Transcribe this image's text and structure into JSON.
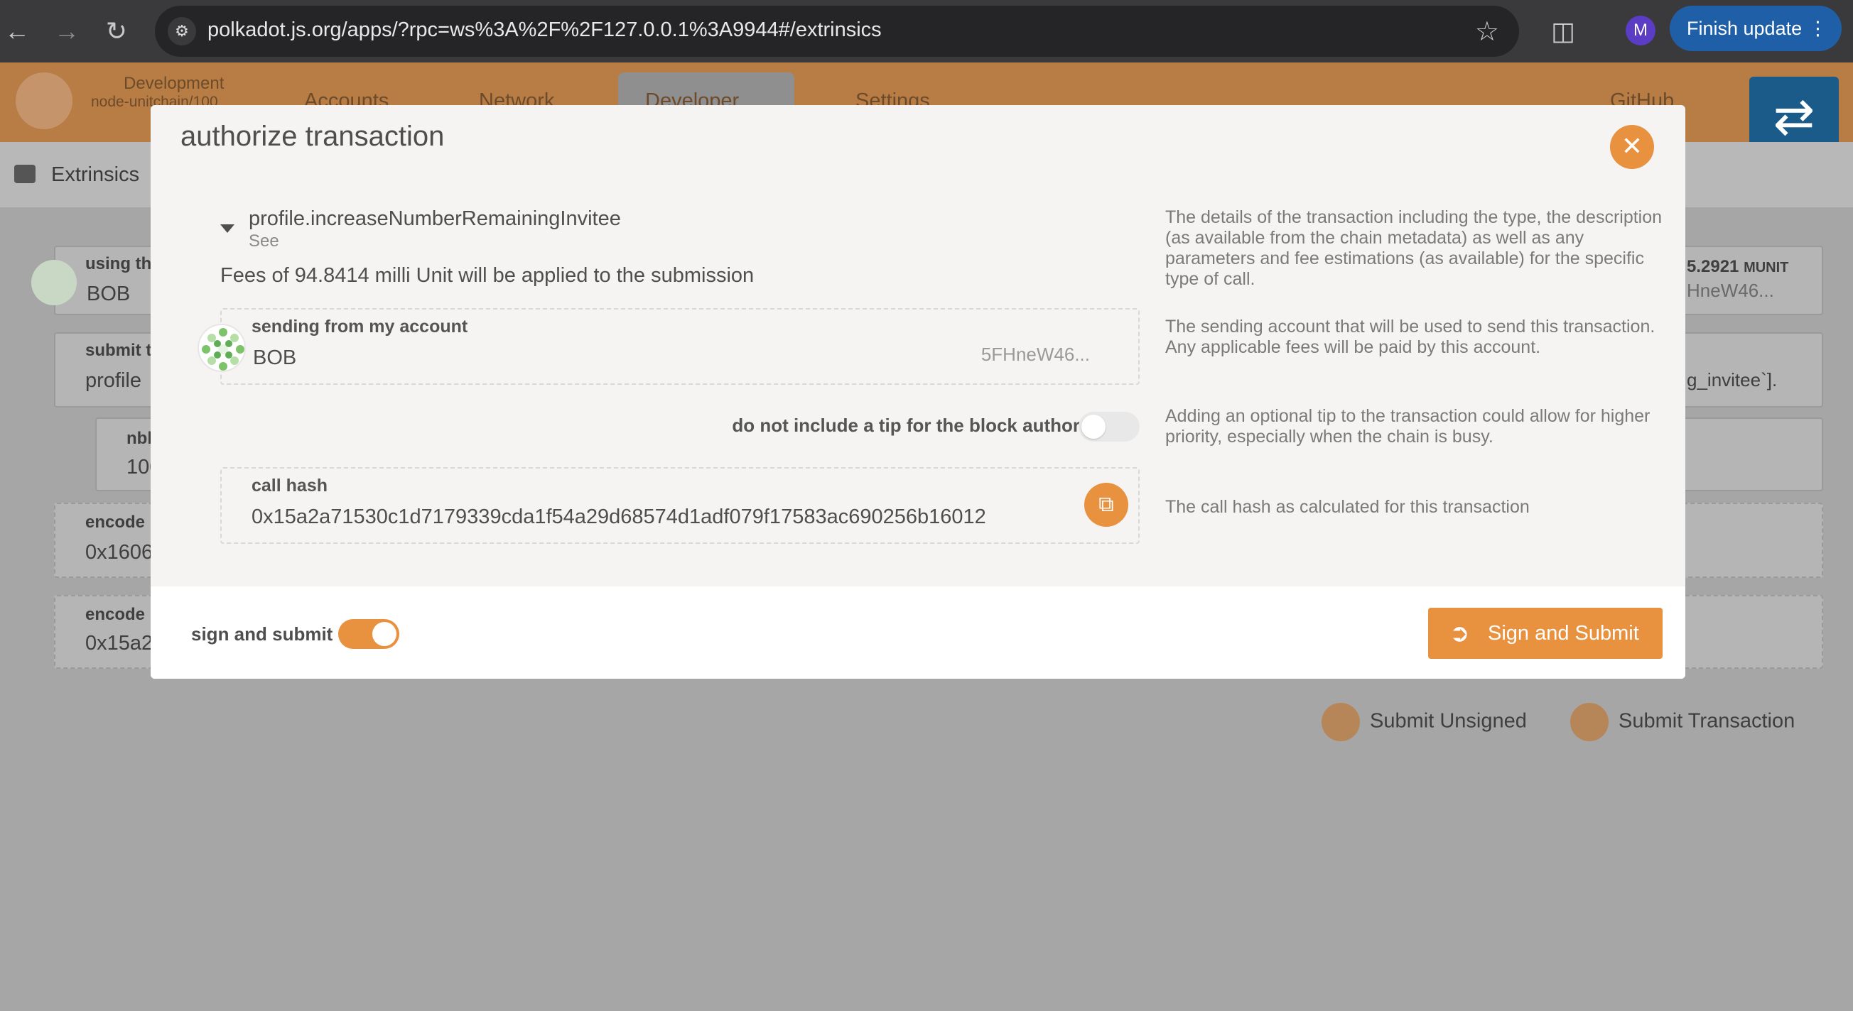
{
  "browser": {
    "url_host": "polkadot.js.org",
    "url_rest": "/apps/?rpc=ws%3A%2F%2F127.0.0.1%3A9944#/extrinsics",
    "profile_initial": "M",
    "finish_update_label": "Finish update"
  },
  "app_header": {
    "chain_label": "Development",
    "chain_sub": "node-unitchain/100",
    "menu": {
      "accounts": "Accounts",
      "network": "Network",
      "developer": "Developer",
      "settings": "Settings",
      "github": "GitHub"
    }
  },
  "subnav": {
    "title": "Extrinsics"
  },
  "background": {
    "using_label": "using th",
    "using_value": "BOB",
    "balance_value": "5.2921",
    "balance_unit": "MUNIT",
    "balance_addr": "HneW46...",
    "submit_label": "submit t",
    "submit_value": "profile",
    "submit_right": "g_invitee`].",
    "nbl_label": "nbl",
    "nbl_value": "100",
    "encoded1_label": "encode",
    "encoded1_value": "0x1606",
    "encoded2_label": "encode",
    "encoded2_value": "0x15a2",
    "submit_unsigned": "Submit Unsigned",
    "submit_transaction": "Submit Transaction"
  },
  "modal": {
    "title": "authorize transaction",
    "method": "profile.increaseNumberRemainingInvitee",
    "see": "See",
    "fees": "Fees of 94.8414 milli Unit will be applied to the submission",
    "account": {
      "label": "sending from my account",
      "name": "BOB",
      "address_short": "5FHneW46..."
    },
    "tip_label": "do not include a tip for the block author",
    "call_hash": {
      "label": "call hash",
      "value": "0x15a2a71530c1d7179339cda1f54a29d68574d1adf079f17583ac690256b16012"
    },
    "help": {
      "details": "The details of the transaction including the type, the description (as available from the chain metadata) as well as any parameters and fee estimations (as available) for the specific type of call.",
      "account": "The sending account that will be used to send this transaction. Any applicable fees will be paid by this account.",
      "tip": "Adding an optional tip to the transaction could allow for higher priority, especially when the chain is busy.",
      "hash": "The call hash as calculated for this transaction"
    },
    "footer": {
      "sign_toggle_label": "sign and submit",
      "sign_button": "Sign and Submit"
    }
  },
  "colors": {
    "accent": "#e8913f",
    "header": "#b87d45",
    "blue": "#1b5b8a"
  }
}
